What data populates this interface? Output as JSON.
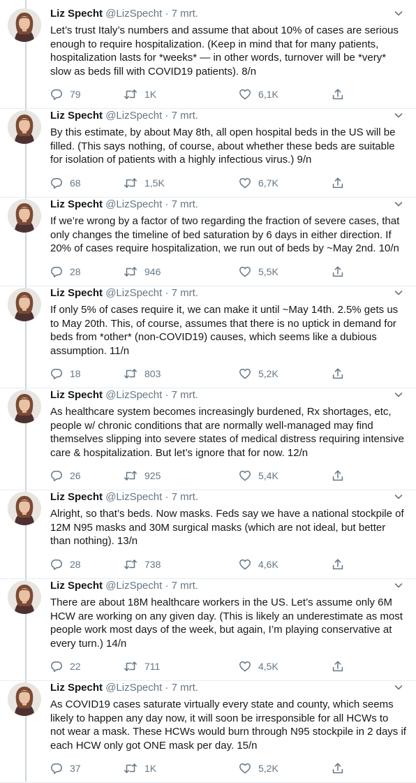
{
  "author": {
    "name": "Liz Specht",
    "handle": "@LizSpecht"
  },
  "date_separator": "·",
  "colors": {
    "text": "#14171a",
    "secondary": "#657786",
    "thread_line": "#ccd6dd"
  },
  "icons": {
    "reply": "reply-icon",
    "retweet": "retweet-icon",
    "like": "like-icon",
    "share": "share-icon",
    "more": "chevron-down-icon"
  },
  "tweets": [
    {
      "date": "7 mrt.",
      "text": "Let’s trust Italy’s numbers and assume that about 10% of cases are serious\nenough to require hospitalization. (Keep in mind that for many patients,\nhospitalization lasts for *weeks* — in other words, turnover will be *very*\nslow as beds fill with COVID19 patients). 8/n",
      "replies": "79",
      "retweets": "1K",
      "likes": "6,1K"
    },
    {
      "date": "7 mrt.",
      "text": "By this estimate, by about May 8th, all open hospital beds in the US will be\nfilled. (This says nothing, of course, about whether these beds are suitable\nfor isolation of patients with a highly infectious virus.) 9/n",
      "replies": "68",
      "retweets": "1,5K",
      "likes": "6,7K"
    },
    {
      "date": "7 mrt.",
      "text": "If we’re wrong by a factor of two regarding the fraction of severe cases, that\nonly changes the timeline of bed saturation by 6 days in either direction. If\n20% of cases require hospitalization, we run out of beds by ~May 2nd. 10/n",
      "replies": "28",
      "retweets": "946",
      "likes": "5,5K"
    },
    {
      "date": "7 mrt.",
      "text": "If only 5% of cases require it, we can make it until ~May 14th. 2.5% gets us\nto May 20th. This, of course, assumes that there is no uptick in demand for\nbeds from *other* (non-COVID19) causes, which seems like a dubious\nassumption. 11/n",
      "replies": "18",
      "retweets": "803",
      "likes": "5,2K"
    },
    {
      "date": "7 mrt.",
      "text": "As healthcare system becomes increasingly burdened, Rx shortages, etc,\npeople w/ chronic conditions that are normally well-managed may find\nthemselves slipping into severe states of medical distress requiring intensive\ncare & hospitalization. But let’s ignore that for now. 12/n",
      "replies": "26",
      "retweets": "925",
      "likes": "5,4K"
    },
    {
      "date": "7 mrt.",
      "text": "Alright, so that’s beds. Now masks. Feds say we have a national stockpile of\n12M N95 masks and 30M surgical masks (which are not ideal, but better\nthan nothing). 13/n",
      "replies": "28",
      "retweets": "738",
      "likes": "4,6K"
    },
    {
      "date": "7 mrt.",
      "text": "There are about 18M healthcare workers in the US. Let’s assume only 6M\nHCW are working on any given day. (This is likely an underestimate as most\npeople work most days of the week, but again, I’m playing conservative at\nevery turn.) 14/n",
      "replies": "22",
      "retweets": "711",
      "likes": "4,5K"
    },
    {
      "date": "7 mrt.",
      "text": "As COVID19 cases saturate virtually every state and county, which seems\nlikely to happen any day now, it will soon be irresponsible for all HCWs to\nnot wear a mask. These HCWs would burn through N95 stockpile in 2 days if\neach HCW only got ONE mask per day. 15/n",
      "replies": "37",
      "retweets": "1K",
      "likes": "5,2K"
    }
  ]
}
